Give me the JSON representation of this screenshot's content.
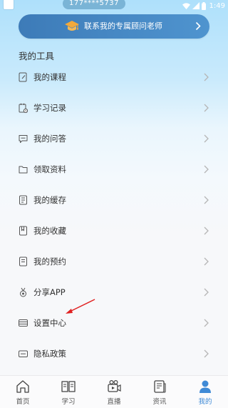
{
  "status_bar": {
    "phone_masked": "177****5737",
    "time": "1:49"
  },
  "banner": {
    "label": "联系我的专属顾问老师",
    "icon": "graduation-cap-icon"
  },
  "section_title": "我的工具",
  "menu": {
    "items": [
      {
        "label": "我的课程",
        "icon": "course-book-icon"
      },
      {
        "label": "学习记录",
        "icon": "study-record-icon"
      },
      {
        "label": "我的问答",
        "icon": "chat-bubble-icon"
      },
      {
        "label": "领取资料",
        "icon": "folder-icon"
      },
      {
        "label": "我的缓存",
        "icon": "cache-download-icon"
      },
      {
        "label": "我的收藏",
        "icon": "bookmark-icon"
      },
      {
        "label": "我的预约",
        "icon": "appointment-icon"
      },
      {
        "label": "分享APP",
        "icon": "share-medal-icon"
      },
      {
        "label": "设置中心",
        "icon": "settings-list-icon"
      },
      {
        "label": "隐私政策",
        "icon": "privacy-policy-icon"
      }
    ]
  },
  "tabs": [
    {
      "label": "首页",
      "icon": "home-icon"
    },
    {
      "label": "学习",
      "icon": "open-book-icon"
    },
    {
      "label": "直播",
      "icon": "live-camera-icon"
    },
    {
      "label": "资讯",
      "icon": "news-icon"
    },
    {
      "label": "我的",
      "icon": "person-icon",
      "active": true
    }
  ],
  "colors": {
    "accent": "#3f8ad6",
    "banner": "#3d7bb8",
    "annotation": "#e02020",
    "text": "#333333",
    "chevron": "#b5b5b5"
  }
}
